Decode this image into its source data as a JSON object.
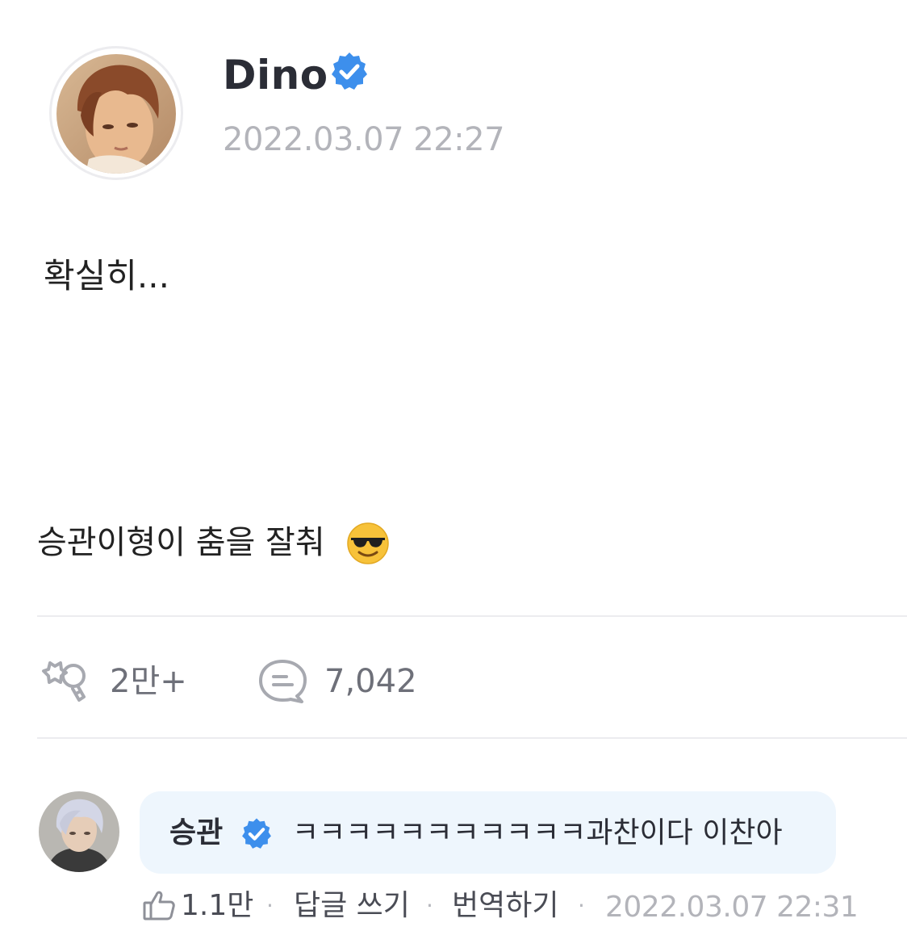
{
  "post": {
    "author": "Dino",
    "timestamp": "2022.03.07 22:27",
    "line1": "확실히...",
    "line2": "승관이형이 춤을 잘춰"
  },
  "stats": {
    "likes": "2만+",
    "comments": "7,042"
  },
  "comment": {
    "author": "승관",
    "text": "ㅋㅋㅋㅋㅋㅋㅋㅋㅋㅋㅋ과찬이다 이찬아",
    "likes": "1.1만",
    "reply_label": "답글 쓰기",
    "translate_label": "번역하기",
    "timestamp": "2022.03.07 22:31",
    "separator": "·"
  },
  "icons": {
    "verified": "verified-badge-icon",
    "like": "like-icon",
    "comment": "comment-icon",
    "thumb": "thumbs-up-icon",
    "emoji": "sunglasses-emoji-icon"
  },
  "colors": {
    "verified": "#3d8fec",
    "bubble": "#eef6fd",
    "muted": "#b3b4ba"
  }
}
